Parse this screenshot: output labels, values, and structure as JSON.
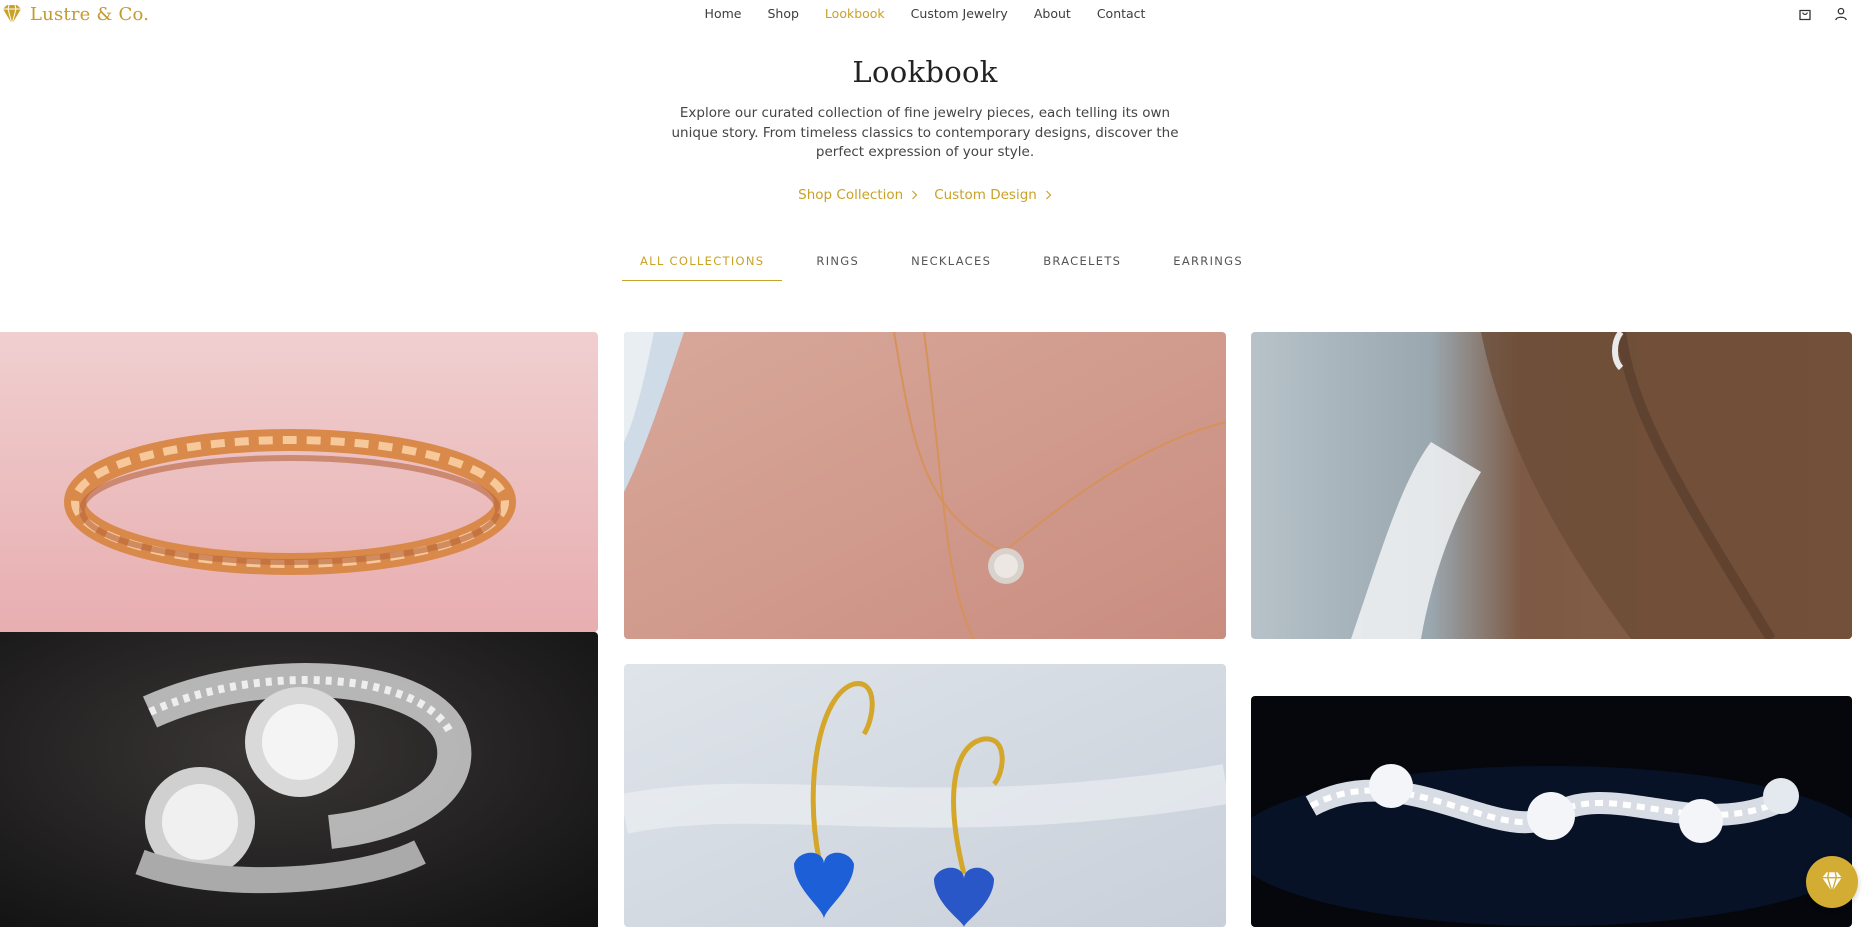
{
  "brand": {
    "name": "Lustre & Co.",
    "logo_icon": "diamond-icon",
    "accent": "#c9a227"
  },
  "nav": {
    "items": [
      {
        "label": "Home",
        "active": false
      },
      {
        "label": "Shop",
        "active": false
      },
      {
        "label": "Lookbook",
        "active": true
      },
      {
        "label": "Custom Jewelry",
        "active": false
      },
      {
        "label": "About",
        "active": false
      },
      {
        "label": "Contact",
        "active": false
      }
    ],
    "icons": [
      "shopping-bag-icon",
      "user-icon"
    ]
  },
  "hero": {
    "title": "Lookbook",
    "description": "Explore our curated collection of fine jewelry pieces, each telling its own unique story. From timeless classics to contemporary designs, discover the perfect expression of your style.",
    "ctas": [
      {
        "label": "Shop Collection",
        "icon": "chevron-right-icon"
      },
      {
        "label": "Custom Design",
        "icon": "chevron-right-icon"
      }
    ]
  },
  "tabs": [
    {
      "label": "ALL COLLECTIONS",
      "active": true
    },
    {
      "label": "RINGS",
      "active": false
    },
    {
      "label": "NECKLACES",
      "active": false
    },
    {
      "label": "BRACELETS",
      "active": false
    },
    {
      "label": "EARRINGS",
      "active": false
    }
  ],
  "gallery": [
    {
      "subject": "rose-gold-bracelet-photo"
    },
    {
      "subject": "diamond-cluster-ring-photo"
    },
    {
      "subject": "gold-pendant-necklace-photo"
    },
    {
      "subject": "blue-heart-earrings-photo"
    },
    {
      "subject": "hoop-earring-portrait-photo"
    },
    {
      "subject": "crystal-bracelet-photo"
    }
  ],
  "floating_button": {
    "icon": "diamond-icon",
    "color": "#d2ac33"
  }
}
